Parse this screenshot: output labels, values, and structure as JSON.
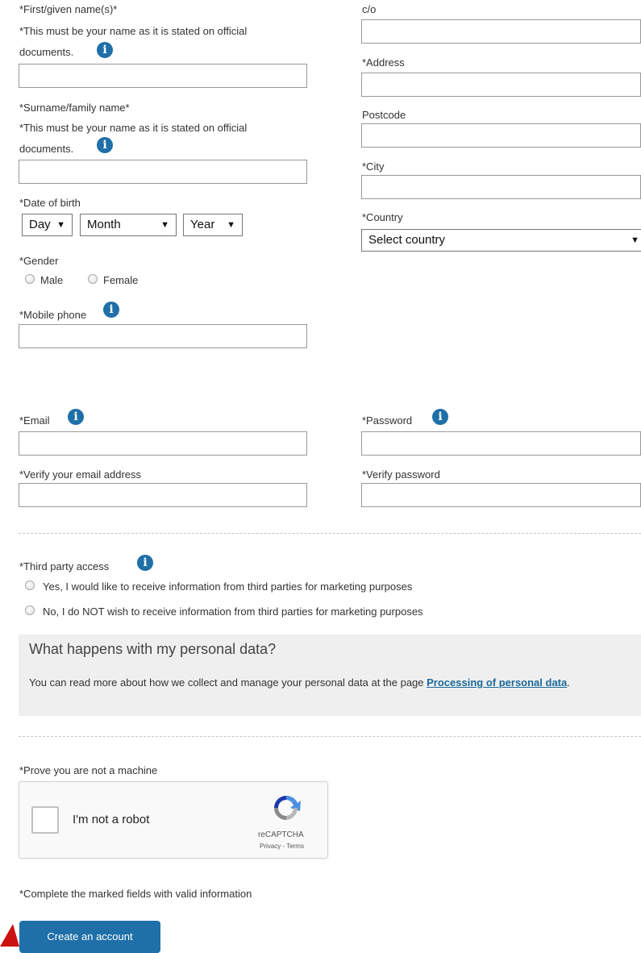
{
  "personal": {
    "first_name_label": "*First/given name(s)*",
    "first_name_hint_line1": "*This must be your name as it is stated on official",
    "first_name_hint_line2": "documents.",
    "first_name_value": "",
    "surname_label": "*Surname/family name*",
    "surname_hint_line1": "*This must be your name as it is stated on official",
    "surname_hint_line2": "documents.",
    "surname_value": "",
    "dob_label": "*Date of birth",
    "dob_day": "Day",
    "dob_month": "Month",
    "dob_year": "Year",
    "gender_label": "*Gender",
    "gender_male": "Male",
    "gender_female": "Female",
    "mobile_label": "*Mobile phone",
    "mobile_value": ""
  },
  "address": {
    "co_label": "c/o",
    "address_label": "*Address",
    "postcode_label": "Postcode",
    "city_label": "*City",
    "country_label": "*Country",
    "country_selected": "Select country"
  },
  "account": {
    "email_label": "*Email",
    "verify_email_label": "*Verify your email address",
    "password_label": "*Password",
    "verify_password_label": "*Verify password"
  },
  "third_party": {
    "label": "*Third party access",
    "option_yes": "Yes, I would like to receive information from third parties for marketing purposes",
    "option_no": "No, I do NOT wish to receive information from third parties for marketing purposes"
  },
  "personal_data": {
    "heading": "What happens with my personal data?",
    "text": "You can read more about how we collect and manage your personal data at the page ",
    "link_text": "Processing of personal data",
    "trailing": "."
  },
  "captcha": {
    "prompt": "*Prove you are not a machine",
    "label": "I'm not a robot",
    "brand": "reCAPTCHA",
    "links": "Privacy - Terms"
  },
  "footer": {
    "note": "*Complete the marked fields with valid information",
    "submit_label": "Create an account"
  },
  "icons": {
    "info": "info-icon",
    "dropdown": "dropdown-arrow-icon"
  },
  "colors": {
    "accent": "#1f6fa8",
    "link": "#1a6a9a",
    "info_box_bg": "#efefef",
    "alert_arrow": "#cc1111"
  }
}
